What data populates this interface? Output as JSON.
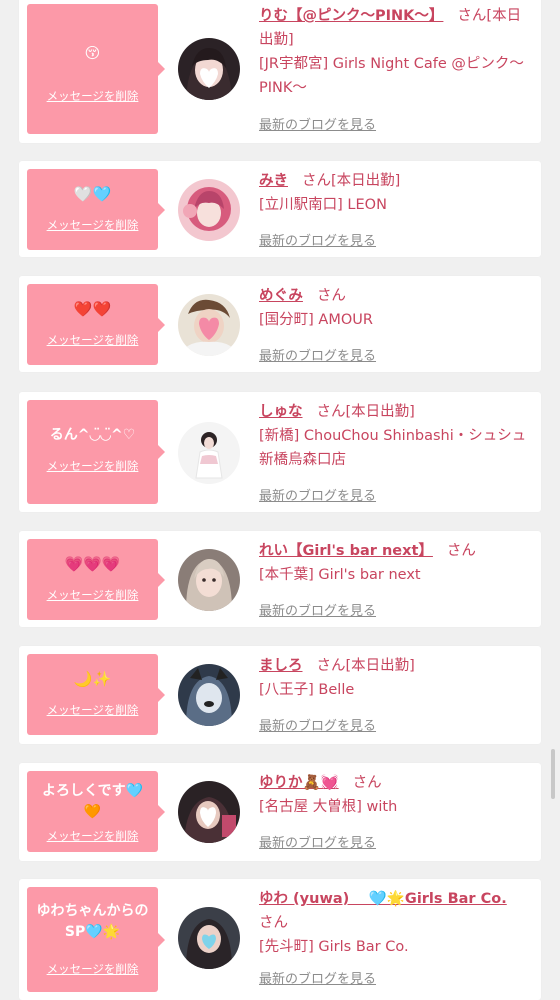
{
  "colors": {
    "accent": "#c8455f",
    "bubble": "#fc99a8",
    "background": "#f0f0f0"
  },
  "entries": [
    {
      "message": "😚",
      "delete_label": "メッセージを削除",
      "name": "りむ【@ピンク〜PINK〜】",
      "suffix": "さん[本日出勤]",
      "shop": "[JR宇都宮] Girls Night Cafe @ピンク〜PINK〜",
      "blog_label": "最新のブログを見る"
    },
    {
      "message": "🤍🩵",
      "delete_label": "メッセージを削除",
      "name": "みき",
      "suffix": "さん[本日出勤]",
      "shop": "[立川駅南口] LEON",
      "blog_label": "最新のブログを見る"
    },
    {
      "message": "❤️❤️",
      "delete_label": "メッセージを削除",
      "name": "めぐみ",
      "suffix": "さん",
      "shop": "[国分町] AMOUR",
      "blog_label": "最新のブログを見る"
    },
    {
      "message": "るん^◡̈◡̈^♡",
      "delete_label": "メッセージを削除",
      "name": "しゅな",
      "suffix": "さん[本日出勤]",
      "shop": "[新橋] ChouChou Shinbashi・シュシュ新橋烏森口店",
      "blog_label": "最新のブログを見る"
    },
    {
      "message": "💗💗💗",
      "delete_label": "メッセージを削除",
      "name": "れい【Girl's bar next】",
      "suffix": "さん",
      "shop": "[本千葉] Girl's bar next",
      "blog_label": "最新のブログを見る"
    },
    {
      "message": "🌙✨",
      "delete_label": "メッセージを削除",
      "name": "ましろ",
      "suffix": "さん[本日出勤]",
      "shop": "[八王子] Belle",
      "blog_label": "最新のブログを見る"
    },
    {
      "message": "よろしくです🩵🧡",
      "delete_label": "メッセージを削除",
      "name": "ゆりか🧸💓",
      "suffix": "さん",
      "shop": "[名古屋 大曽根] with",
      "blog_label": "最新のブログを見る"
    },
    {
      "message": "ゆわちゃんからのSP🩵🌟",
      "delete_label": "メッセージを削除",
      "name": "ゆわ (yuwa)　 🩵🌟Girls Bar Co.",
      "suffix": "さん",
      "shop": "[先斗町] Girls Bar Co.",
      "blog_label": "最新のブログを見る"
    }
  ]
}
